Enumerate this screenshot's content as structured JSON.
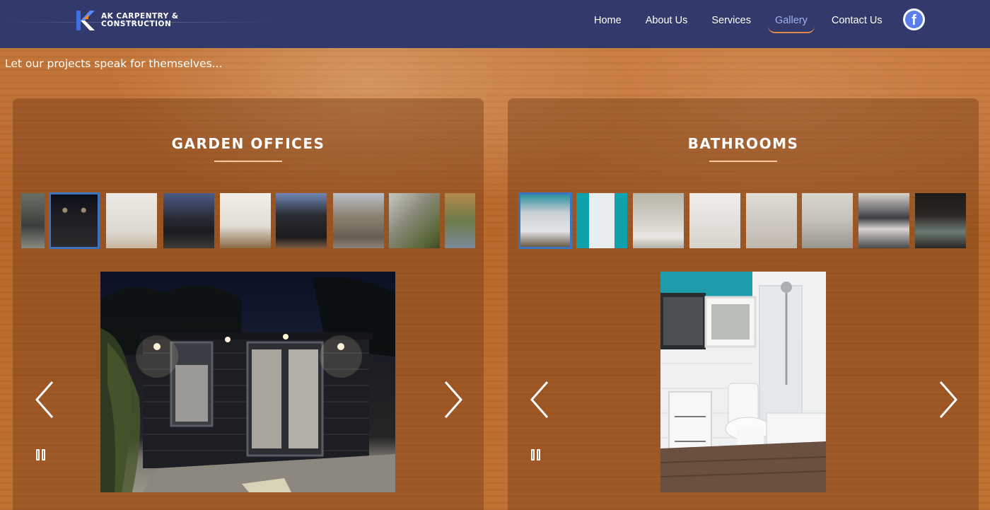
{
  "header": {
    "logo_line1": "AK CARPENTRY &",
    "logo_line2": "CONSTRUCTION",
    "nav": [
      {
        "label": "Home"
      },
      {
        "label": "About Us"
      },
      {
        "label": "Services"
      },
      {
        "label": "Gallery",
        "active": true
      },
      {
        "label": "Contact Us"
      }
    ],
    "social_icon": "facebook-icon"
  },
  "tagline": "Let our projects speak for themselves...",
  "galleries": [
    {
      "title": "GARDEN OFFICES",
      "selected_thumb": 1,
      "thumb_count": 9,
      "main_image": "garden office at night"
    },
    {
      "title": "BATHROOMS",
      "selected_thumb": 0,
      "thumb_count": 8,
      "main_image": "bathroom with teal wall"
    }
  ],
  "colors": {
    "header_bg": "#32396b",
    "accent_underline": "#e2894b",
    "thumb_selected": "#3c74bf",
    "active_nav": "#9fb3f0"
  }
}
